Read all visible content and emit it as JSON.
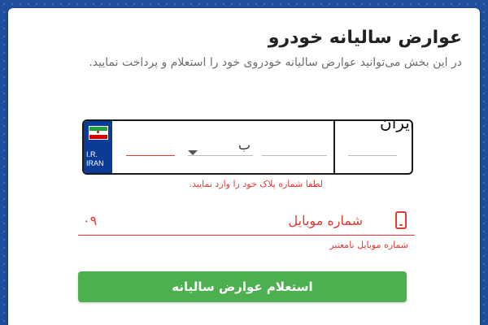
{
  "page": {
    "title": "عوارض سالیانه خودرو",
    "description": "در این بخش می‌توانید عوارض سالیانه خودروی خود را استعلام و پرداخت نمایید."
  },
  "plate": {
    "country_code_line1": "I.R.",
    "country_code_line2": "IRAN",
    "selected_letter": "ب",
    "iran_label": "ایران",
    "error": "لطفا شماره پلاک خود را وارد نمایید."
  },
  "mobile": {
    "value": "۰۹",
    "label": "شماره موبایل",
    "error": "شماره موبایل نامعتبر"
  },
  "submit": {
    "label": "استعلام عوارض سالیانه"
  },
  "colors": {
    "background": "#1f4f9e",
    "error": "#e53935",
    "button": "#4caf50",
    "plate_strip": "#0a3b96"
  }
}
